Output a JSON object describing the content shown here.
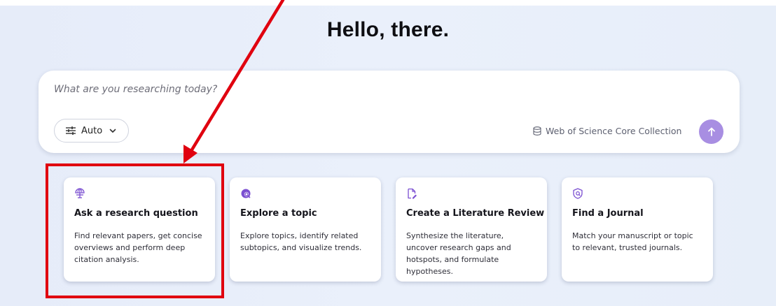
{
  "header": {
    "greeting": "Hello, there."
  },
  "search": {
    "placeholder": "What are you researching today?",
    "mode_label": "Auto",
    "mode_icon": "sliders-icon",
    "collection_label": "Web of Science Core Collection",
    "collection_icon": "database-icon",
    "submit_icon": "arrow-up-icon",
    "submit_color": "#a88ee2"
  },
  "cards": [
    {
      "icon": "globe-stand-icon",
      "title": "Ask a research question",
      "description": "Find relevant papers, get concise overviews and perform deep citation analysis."
    },
    {
      "icon": "globe-search-icon",
      "title": "Explore a topic",
      "description": "Explore topics, identify related subtopics, and visualize trends."
    },
    {
      "icon": "document-edit-icon",
      "title": "Create a Literature Review",
      "description": "Synthesize the literature, uncover research gaps and hotspots, and formulate hypotheses."
    },
    {
      "icon": "journal-shield-icon",
      "title": "Find a Journal",
      "description": "Match your manuscript or topic to relevant, trusted journals."
    }
  ],
  "colors": {
    "accent": "#7b4fd1",
    "annotation": "#e0000f",
    "background": "#e8eefa"
  }
}
